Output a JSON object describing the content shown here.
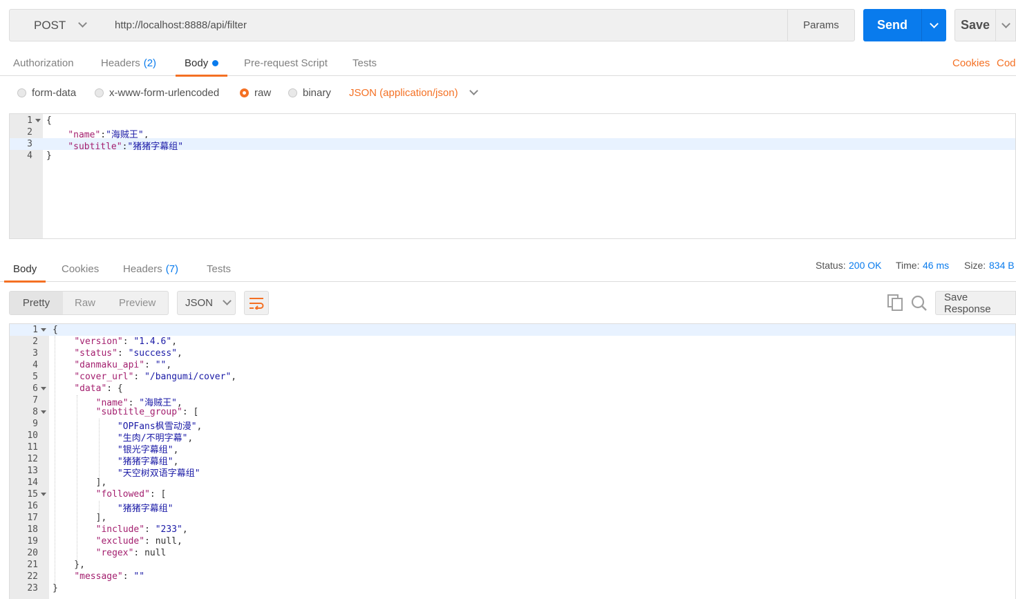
{
  "request": {
    "method": "POST",
    "url": "http://localhost:8888/api/filter",
    "params_label": "Params",
    "send_label": "Send",
    "save_label": "Save"
  },
  "request_tabs": {
    "authorization": "Authorization",
    "headers": "Headers",
    "headers_count": "(2)",
    "body": "Body",
    "prerequest": "Pre-request Script",
    "tests": "Tests",
    "cookies": "Cookies",
    "code": "Cod"
  },
  "body_types": {
    "form_data": "form-data",
    "urlencoded": "x-www-form-urlencoded",
    "raw": "raw",
    "binary": "binary",
    "selected": "raw",
    "content_type": "JSON (application/json)"
  },
  "request_body": {
    "lines": [
      {
        "n": "1",
        "fold": true,
        "segs": [
          {
            "t": "{",
            "c": "p"
          }
        ]
      },
      {
        "n": "2",
        "fold": false,
        "segs": [
          {
            "t": "    ",
            "c": "p"
          },
          {
            "t": "\"name\"",
            "c": "k"
          },
          {
            "t": ":",
            "c": "p"
          },
          {
            "t": "\"海贼王\"",
            "c": "s"
          },
          {
            "t": ",",
            "c": "p"
          }
        ]
      },
      {
        "n": "3",
        "fold": false,
        "segs": [
          {
            "t": "    ",
            "c": "p"
          },
          {
            "t": "\"subtitle\"",
            "c": "k"
          },
          {
            "t": ":",
            "c": "p"
          },
          {
            "t": "\"猪猪字幕组\"",
            "c": "s"
          }
        ]
      },
      {
        "n": "4",
        "fold": false,
        "segs": [
          {
            "t": "}",
            "c": "p"
          }
        ]
      }
    ]
  },
  "response_tabs": {
    "body": "Body",
    "cookies": "Cookies",
    "headers": "Headers",
    "headers_count": "(7)",
    "tests": "Tests"
  },
  "response_meta": {
    "status_label": "Status:",
    "status_value": "200 OK",
    "time_label": "Time:",
    "time_value": "46 ms",
    "size_label": "Size:",
    "size_value": "834 B"
  },
  "response_toolbar": {
    "pretty": "Pretty",
    "raw": "Raw",
    "preview": "Preview",
    "language": "JSON",
    "save_response": "Save Response"
  },
  "response_body": {
    "lines": [
      {
        "n": "1",
        "fold": true,
        "segs": [
          {
            "t": "{",
            "c": "p"
          }
        ]
      },
      {
        "n": "2",
        "fold": false,
        "segs": [
          {
            "t": "    ",
            "c": "p"
          },
          {
            "t": "\"version\"",
            "c": "k"
          },
          {
            "t": ": ",
            "c": "p"
          },
          {
            "t": "\"1.4.6\"",
            "c": "s"
          },
          {
            "t": ",",
            "c": "p"
          }
        ]
      },
      {
        "n": "3",
        "fold": false,
        "segs": [
          {
            "t": "    ",
            "c": "p"
          },
          {
            "t": "\"status\"",
            "c": "k"
          },
          {
            "t": ": ",
            "c": "p"
          },
          {
            "t": "\"success\"",
            "c": "s"
          },
          {
            "t": ",",
            "c": "p"
          }
        ]
      },
      {
        "n": "4",
        "fold": false,
        "segs": [
          {
            "t": "    ",
            "c": "p"
          },
          {
            "t": "\"danmaku_api\"",
            "c": "k"
          },
          {
            "t": ": ",
            "c": "p"
          },
          {
            "t": "\"\"",
            "c": "s"
          },
          {
            "t": ",",
            "c": "p"
          }
        ]
      },
      {
        "n": "5",
        "fold": false,
        "segs": [
          {
            "t": "    ",
            "c": "p"
          },
          {
            "t": "\"cover_url\"",
            "c": "k"
          },
          {
            "t": ": ",
            "c": "p"
          },
          {
            "t": "\"/bangumi/cover\"",
            "c": "s"
          },
          {
            "t": ",",
            "c": "p"
          }
        ]
      },
      {
        "n": "6",
        "fold": true,
        "segs": [
          {
            "t": "    ",
            "c": "p"
          },
          {
            "t": "\"data\"",
            "c": "k"
          },
          {
            "t": ": {",
            "c": "p"
          }
        ]
      },
      {
        "n": "7",
        "fold": false,
        "segs": [
          {
            "t": "        ",
            "c": "p"
          },
          {
            "t": "\"name\"",
            "c": "k"
          },
          {
            "t": ": ",
            "c": "p"
          },
          {
            "t": "\"海贼王\"",
            "c": "s"
          },
          {
            "t": ",",
            "c": "p"
          }
        ]
      },
      {
        "n": "8",
        "fold": true,
        "segs": [
          {
            "t": "        ",
            "c": "p"
          },
          {
            "t": "\"subtitle_group\"",
            "c": "k"
          },
          {
            "t": ": [",
            "c": "p"
          }
        ]
      },
      {
        "n": "9",
        "fold": false,
        "segs": [
          {
            "t": "            ",
            "c": "p"
          },
          {
            "t": "\"OPFans枫雪动漫\"",
            "c": "s"
          },
          {
            "t": ",",
            "c": "p"
          }
        ]
      },
      {
        "n": "10",
        "fold": false,
        "segs": [
          {
            "t": "            ",
            "c": "p"
          },
          {
            "t": "\"生肉/不明字幕\"",
            "c": "s"
          },
          {
            "t": ",",
            "c": "p"
          }
        ]
      },
      {
        "n": "11",
        "fold": false,
        "segs": [
          {
            "t": "            ",
            "c": "p"
          },
          {
            "t": "\"银光字幕组\"",
            "c": "s"
          },
          {
            "t": ",",
            "c": "p"
          }
        ]
      },
      {
        "n": "12",
        "fold": false,
        "segs": [
          {
            "t": "            ",
            "c": "p"
          },
          {
            "t": "\"猪猪字幕组\"",
            "c": "s"
          },
          {
            "t": ",",
            "c": "p"
          }
        ]
      },
      {
        "n": "13",
        "fold": false,
        "segs": [
          {
            "t": "            ",
            "c": "p"
          },
          {
            "t": "\"天空树双语字幕组\"",
            "c": "s"
          }
        ]
      },
      {
        "n": "14",
        "fold": false,
        "segs": [
          {
            "t": "        ],",
            "c": "p"
          }
        ]
      },
      {
        "n": "15",
        "fold": true,
        "segs": [
          {
            "t": "        ",
            "c": "p"
          },
          {
            "t": "\"followed\"",
            "c": "k"
          },
          {
            "t": ": [",
            "c": "p"
          }
        ]
      },
      {
        "n": "16",
        "fold": false,
        "segs": [
          {
            "t": "            ",
            "c": "p"
          },
          {
            "t": "\"猪猪字幕组\"",
            "c": "s"
          }
        ]
      },
      {
        "n": "17",
        "fold": false,
        "segs": [
          {
            "t": "        ],",
            "c": "p"
          }
        ]
      },
      {
        "n": "18",
        "fold": false,
        "segs": [
          {
            "t": "        ",
            "c": "p"
          },
          {
            "t": "\"include\"",
            "c": "k"
          },
          {
            "t": ": ",
            "c": "p"
          },
          {
            "t": "\"233\"",
            "c": "s"
          },
          {
            "t": ",",
            "c": "p"
          }
        ]
      },
      {
        "n": "19",
        "fold": false,
        "segs": [
          {
            "t": "        ",
            "c": "p"
          },
          {
            "t": "\"exclude\"",
            "c": "k"
          },
          {
            "t": ": null,",
            "c": "p"
          }
        ]
      },
      {
        "n": "20",
        "fold": false,
        "segs": [
          {
            "t": "        ",
            "c": "p"
          },
          {
            "t": "\"regex\"",
            "c": "k"
          },
          {
            "t": ": null",
            "c": "p"
          }
        ]
      },
      {
        "n": "21",
        "fold": false,
        "segs": [
          {
            "t": "    },",
            "c": "p"
          }
        ]
      },
      {
        "n": "22",
        "fold": false,
        "segs": [
          {
            "t": "    ",
            "c": "p"
          },
          {
            "t": "\"message\"",
            "c": "k"
          },
          {
            "t": ": ",
            "c": "p"
          },
          {
            "t": "\"\"",
            "c": "s"
          }
        ]
      },
      {
        "n": "23",
        "fold": false,
        "segs": [
          {
            "t": "}",
            "c": "p"
          }
        ]
      }
    ]
  },
  "colors": {
    "accent_orange": "#f47023",
    "accent_blue": "#097bed"
  }
}
